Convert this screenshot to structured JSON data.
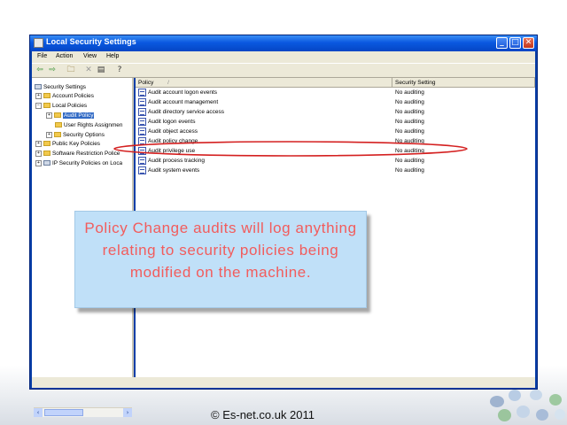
{
  "window": {
    "title": "Local Security Settings",
    "buttons": {
      "minimize": "_",
      "maximize": "□",
      "close": "✕"
    }
  },
  "menubar": {
    "items": [
      "File",
      "Action",
      "View",
      "Help"
    ]
  },
  "toolbar": {
    "icons": [
      "back-icon",
      "forward-icon",
      "up-folder-icon",
      "delete-icon",
      "export-list-icon",
      "help-icon"
    ]
  },
  "tree": {
    "items": [
      {
        "label": "Security Settings",
        "expander": ""
      },
      {
        "label": "Account Policies",
        "expander": "+"
      },
      {
        "label": "Local Policies",
        "expander": "−"
      },
      {
        "label": "Audit Policy",
        "expander": "+"
      },
      {
        "label": "User Rights Assignmen",
        "expander": ""
      },
      {
        "label": "Security Options",
        "expander": "+"
      },
      {
        "label": "Public Key Policies",
        "expander": "+"
      },
      {
        "label": "Software Restriction Police",
        "expander": "+"
      },
      {
        "label": "IP Security Policies on Loca",
        "expander": "+"
      }
    ],
    "scroll_left": "‹",
    "scroll_right": "›"
  },
  "list": {
    "columns": {
      "policy": "Policy",
      "sort_indicator": "/",
      "setting": "Security Setting"
    },
    "rows": [
      {
        "policy": "Audit account logon events",
        "setting": "No auditing"
      },
      {
        "policy": "Audit account management",
        "setting": "No auditing"
      },
      {
        "policy": "Audit directory service access",
        "setting": "No auditing"
      },
      {
        "policy": "Audit logon events",
        "setting": "No auditing"
      },
      {
        "policy": "Audit object access",
        "setting": "No auditing"
      },
      {
        "policy": "Audit policy change",
        "setting": "No auditing"
      },
      {
        "policy": "Audit privilege use",
        "setting": "No auditing"
      },
      {
        "policy": "Audit process tracking",
        "setting": "No auditing"
      },
      {
        "policy": "Audit system events",
        "setting": "No auditing"
      }
    ]
  },
  "callout": {
    "text": "Policy Change audits will log anything relating to security policies being modified on the machine."
  },
  "footer": {
    "copyright": "© Es-net.co.uk 2011"
  },
  "colors": {
    "annotation_ellipse": "#d42020",
    "callout_text": "#f25c5c",
    "callout_bg": "#c0e0f8",
    "selection": "#316ac5"
  }
}
